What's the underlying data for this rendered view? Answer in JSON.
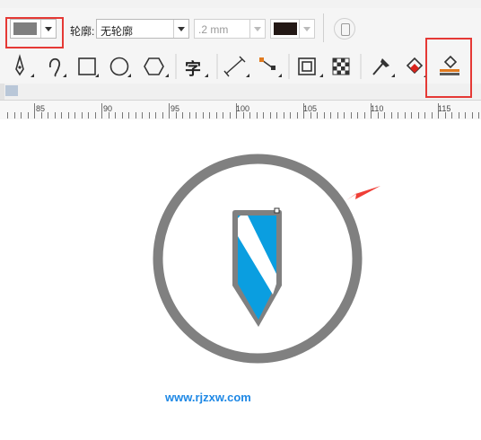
{
  "property_bar": {
    "fill_color": "#7f7f7f",
    "outline_label": "轮廓:",
    "outline_value": "无轮廓",
    "width_value": ".2 mm",
    "outline_color": "#231815"
  },
  "toolbar": {
    "text_tool_glyph": "字",
    "tools": [
      "pen-tool",
      "curve-tool",
      "rectangle-tool",
      "ellipse-tool",
      "polygon-tool",
      "text-tool",
      "dimension-tool",
      "connector-tool",
      "drop-shadow-tool",
      "transparency-tool",
      "eyedropper-tool",
      "interactive-fill-tool",
      "smart-fill-tool"
    ]
  },
  "ruler": {
    "labels": [
      "85",
      "90",
      "95",
      "100",
      "105",
      "110",
      "115"
    ]
  },
  "canvas": {
    "ring_color": "#808080",
    "shield_color": "#0a9ee0",
    "watermark": "www.rjzxw.com"
  },
  "colors": {
    "highlight": "#e53935",
    "arrow": "#ef3e36"
  }
}
